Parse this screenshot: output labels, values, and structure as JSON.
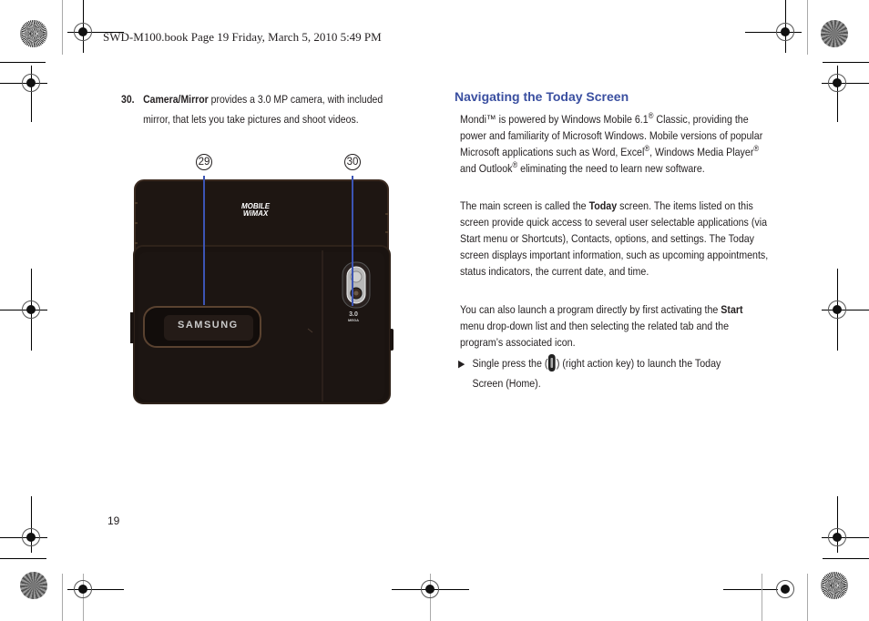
{
  "header": {
    "book_info": "SWD-M100.book  Page 19  Friday, March 5, 2010  5:49 PM"
  },
  "left_column": {
    "item": {
      "number": "30.",
      "term": "Camera/Mirror",
      "text_line1": " provides a 3.0 MP camera, with included",
      "text_line2": "mirror, that lets you take pictures and shoot videos."
    },
    "figure": {
      "callouts": [
        "29",
        "30"
      ],
      "phone_labels": {
        "brand": "SAMSUNG",
        "logo_line1": "MOBILE",
        "logo_line2": "WiMAX",
        "camera_mp": "3.0",
        "camera_unit": "MEGA"
      },
      "colors": {
        "callout_line": "#3c54b4",
        "phone_body": "#1e1612"
      }
    }
  },
  "right_column": {
    "section_title": "Navigating the Today Screen",
    "paragraph1": {
      "part1": "Mondi™ is powered by Windows Mobile 6.1",
      "reg1": "®",
      "part2": " Classic, providing the power and familiarity of Microsoft Windows. Mobile versions of popular Microsoft applications such as Word, Excel",
      "reg2": "®",
      "part3": ", Windows Media Player",
      "reg3": "®",
      "part4": " and Outlook",
      "reg4": "®",
      "part5": " eliminating the need to learn new software."
    },
    "paragraph2": {
      "part1": "The main screen is called the ",
      "bold": "Today",
      "part2": " screen. The items listed on this screen provide quick access to several user selectable applications (via Start menu or Shortcuts), Contacts, options, and settings. The Today screen displays important information, such as upcoming appointments, status indicators, the current date, and time."
    },
    "paragraph3": {
      "part1": "You can also launch a program directly by first activating the ",
      "bold": "Start",
      "part2": " menu drop-down list and then selecting the related tab and the program’s associated icon."
    },
    "bullet": {
      "marker": "▶",
      "part1": "Single press the (",
      "icon": "right-action-key-icon",
      "part2": ") (right action key) to launch the Today",
      "line2": "Screen (Home)."
    },
    "colors": {
      "section_title": "#3a4fa0"
    }
  },
  "footer": {
    "page_number": "19"
  }
}
